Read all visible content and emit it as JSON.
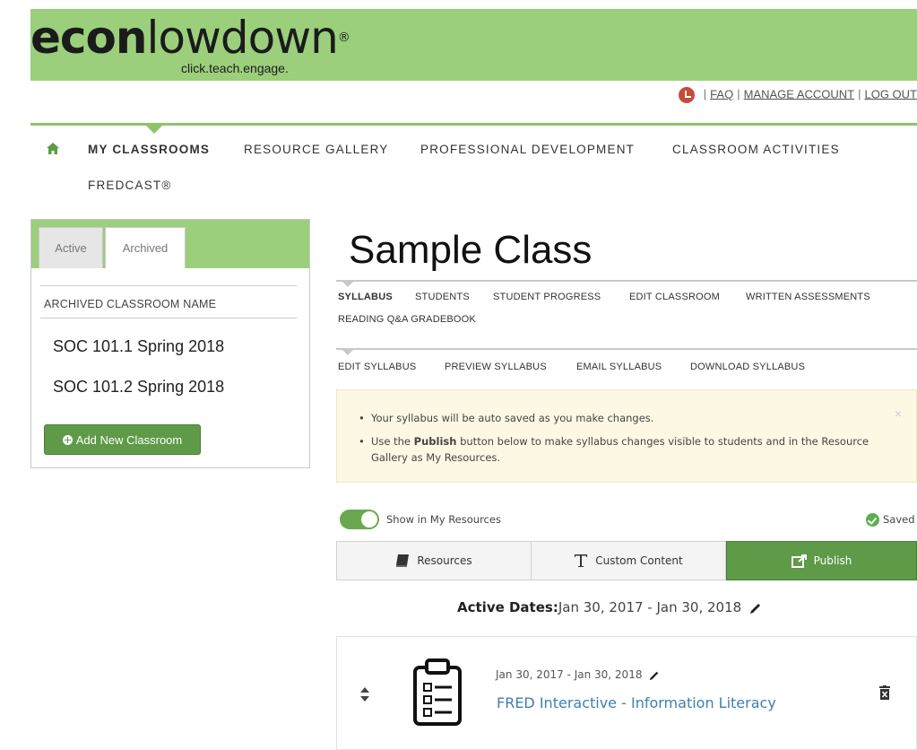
{
  "brand": {
    "logo_bold": "econ",
    "logo_light": "lowdown",
    "registered": "®",
    "tagline": "click.teach.engage."
  },
  "top_links": {
    "faq": "FAQ",
    "manage_account": "MANAGE ACCOUNT",
    "log_out": "LOG OUT",
    "separator": "|"
  },
  "main_nav": {
    "items": [
      "MY CLASSROOMS",
      "RESOURCE GALLERY",
      "PROFESSIONAL DEVELOPMENT",
      "CLASSROOM ACTIVITIES",
      "FREDCAST®"
    ]
  },
  "sidebar": {
    "tabs": [
      "Active",
      "Archived"
    ],
    "header": "ARCHIVED CLASSROOM NAME",
    "items": [
      "SOC 101.1 Spring 2018",
      "SOC 101.2 Spring 2018"
    ],
    "add_button": "Add New Classroom"
  },
  "page": {
    "title": "Sample Class"
  },
  "class_nav": {
    "items": [
      "SYLLABUS",
      "STUDENTS",
      "STUDENT PROGRESS",
      "EDIT CLASSROOM",
      "WRITTEN ASSESSMENTS",
      "READING Q&A GRADEBOOK"
    ]
  },
  "syllabus_nav": {
    "items": [
      "EDIT SYLLABUS",
      "PREVIEW SYLLABUS",
      "EMAIL SYLLABUS",
      "DOWNLOAD SYLLABUS"
    ]
  },
  "alert": {
    "line1": "Your syllabus will be auto saved as you make changes.",
    "line2_pre": "Use the ",
    "line2_bold": "Publish",
    "line2_post": " button below to make syllabus changes visible to students and in the Resource Gallery as My Resources.",
    "close": "×"
  },
  "toggle": {
    "label": "Show in My Resources",
    "on": true
  },
  "status": {
    "saved": "Saved"
  },
  "actions": {
    "resources": "Resources",
    "custom_content": "Custom Content",
    "publish": "Publish"
  },
  "active_dates": {
    "label": "Active Dates:",
    "value": "Jan 30, 2017 - Jan 30, 2018"
  },
  "resource_item": {
    "dates": "Jan 30, 2017 - Jan 30, 2018",
    "title": "FRED Interactive - Information Literacy"
  },
  "colors": {
    "brand_green": "#9bcf7b",
    "button_green": "#5e9a48",
    "link_blue": "#3f7fb0",
    "alert_bg": "#fcf8e3"
  }
}
